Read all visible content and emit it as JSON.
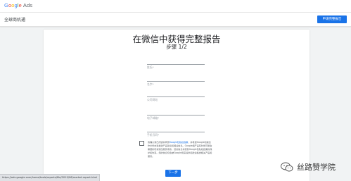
{
  "header": {
    "logo_letters": [
      "G",
      "o",
      "o",
      "g",
      "l",
      "e"
    ],
    "logo_product": "Ads",
    "subbar_title": "全球商机通",
    "cta_label": "申请完整报告"
  },
  "form": {
    "title": "在微信中获得完整报告",
    "step": "步骤 1/2",
    "fields": [
      {
        "placeholder": "姓氏*"
      },
      {
        "placeholder": "名字*"
      },
      {
        "placeholder": "公司网站"
      },
      {
        "placeholder": "电子邮箱*"
      },
      {
        "placeholder": "手机号码*"
      }
    ],
    "consent": {
      "pre": "我确认我已阅读并同意",
      "link": "Google隐私权政策",
      "post": "，并希望Google和其合作伙伴向我发送产品建议和相关信息。Google相产品有时候可能会需要新增或修改服务条款，您的信息将受到Google隐私权政策的保护和约束。您的信息仅会被Google用来提供和改进各类相关产品和服务。"
    },
    "next_label": "下一步"
  },
  "status_url": "https://ads.google.com/home/tools/reports/file/2019/06/market-report.html",
  "watermark": {
    "text": "丝路赞学院"
  },
  "colors": {
    "primary": "#1a73e8",
    "background": "#f1f3f4"
  }
}
